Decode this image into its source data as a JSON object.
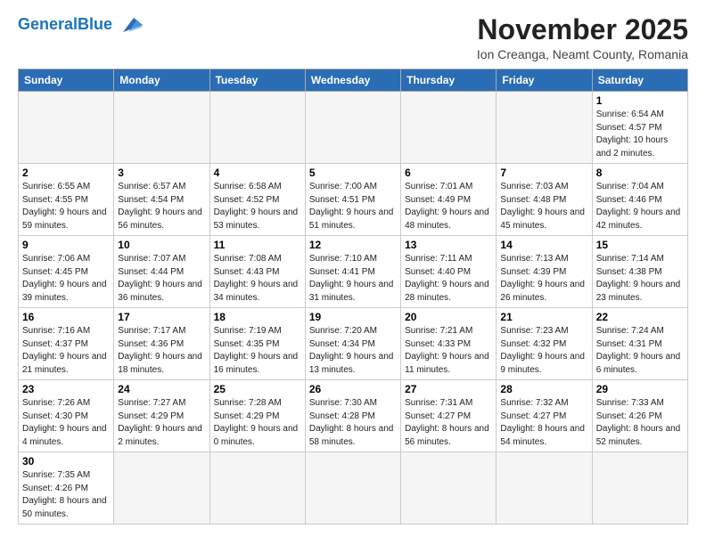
{
  "header": {
    "logo_general": "General",
    "logo_blue": "Blue",
    "title": "November 2025",
    "subtitle": "Ion Creanga, Neamt County, Romania"
  },
  "days_of_week": [
    "Sunday",
    "Monday",
    "Tuesday",
    "Wednesday",
    "Thursday",
    "Friday",
    "Saturday"
  ],
  "weeks": [
    [
      {
        "day": "",
        "info": ""
      },
      {
        "day": "",
        "info": ""
      },
      {
        "day": "",
        "info": ""
      },
      {
        "day": "",
        "info": ""
      },
      {
        "day": "",
        "info": ""
      },
      {
        "day": "",
        "info": ""
      },
      {
        "day": "1",
        "info": "Sunrise: 6:54 AM\nSunset: 4:57 PM\nDaylight: 10 hours and 2 minutes."
      }
    ],
    [
      {
        "day": "2",
        "info": "Sunrise: 6:55 AM\nSunset: 4:55 PM\nDaylight: 9 hours and 59 minutes."
      },
      {
        "day": "3",
        "info": "Sunrise: 6:57 AM\nSunset: 4:54 PM\nDaylight: 9 hours and 56 minutes."
      },
      {
        "day": "4",
        "info": "Sunrise: 6:58 AM\nSunset: 4:52 PM\nDaylight: 9 hours and 53 minutes."
      },
      {
        "day": "5",
        "info": "Sunrise: 7:00 AM\nSunset: 4:51 PM\nDaylight: 9 hours and 51 minutes."
      },
      {
        "day": "6",
        "info": "Sunrise: 7:01 AM\nSunset: 4:49 PM\nDaylight: 9 hours and 48 minutes."
      },
      {
        "day": "7",
        "info": "Sunrise: 7:03 AM\nSunset: 4:48 PM\nDaylight: 9 hours and 45 minutes."
      },
      {
        "day": "8",
        "info": "Sunrise: 7:04 AM\nSunset: 4:46 PM\nDaylight: 9 hours and 42 minutes."
      }
    ],
    [
      {
        "day": "9",
        "info": "Sunrise: 7:06 AM\nSunset: 4:45 PM\nDaylight: 9 hours and 39 minutes."
      },
      {
        "day": "10",
        "info": "Sunrise: 7:07 AM\nSunset: 4:44 PM\nDaylight: 9 hours and 36 minutes."
      },
      {
        "day": "11",
        "info": "Sunrise: 7:08 AM\nSunset: 4:43 PM\nDaylight: 9 hours and 34 minutes."
      },
      {
        "day": "12",
        "info": "Sunrise: 7:10 AM\nSunset: 4:41 PM\nDaylight: 9 hours and 31 minutes."
      },
      {
        "day": "13",
        "info": "Sunrise: 7:11 AM\nSunset: 4:40 PM\nDaylight: 9 hours and 28 minutes."
      },
      {
        "day": "14",
        "info": "Sunrise: 7:13 AM\nSunset: 4:39 PM\nDaylight: 9 hours and 26 minutes."
      },
      {
        "day": "15",
        "info": "Sunrise: 7:14 AM\nSunset: 4:38 PM\nDaylight: 9 hours and 23 minutes."
      }
    ],
    [
      {
        "day": "16",
        "info": "Sunrise: 7:16 AM\nSunset: 4:37 PM\nDaylight: 9 hours and 21 minutes."
      },
      {
        "day": "17",
        "info": "Sunrise: 7:17 AM\nSunset: 4:36 PM\nDaylight: 9 hours and 18 minutes."
      },
      {
        "day": "18",
        "info": "Sunrise: 7:19 AM\nSunset: 4:35 PM\nDaylight: 9 hours and 16 minutes."
      },
      {
        "day": "19",
        "info": "Sunrise: 7:20 AM\nSunset: 4:34 PM\nDaylight: 9 hours and 13 minutes."
      },
      {
        "day": "20",
        "info": "Sunrise: 7:21 AM\nSunset: 4:33 PM\nDaylight: 9 hours and 11 minutes."
      },
      {
        "day": "21",
        "info": "Sunrise: 7:23 AM\nSunset: 4:32 PM\nDaylight: 9 hours and 9 minutes."
      },
      {
        "day": "22",
        "info": "Sunrise: 7:24 AM\nSunset: 4:31 PM\nDaylight: 9 hours and 6 minutes."
      }
    ],
    [
      {
        "day": "23",
        "info": "Sunrise: 7:26 AM\nSunset: 4:30 PM\nDaylight: 9 hours and 4 minutes."
      },
      {
        "day": "24",
        "info": "Sunrise: 7:27 AM\nSunset: 4:29 PM\nDaylight: 9 hours and 2 minutes."
      },
      {
        "day": "25",
        "info": "Sunrise: 7:28 AM\nSunset: 4:29 PM\nDaylight: 9 hours and 0 minutes."
      },
      {
        "day": "26",
        "info": "Sunrise: 7:30 AM\nSunset: 4:28 PM\nDaylight: 8 hours and 58 minutes."
      },
      {
        "day": "27",
        "info": "Sunrise: 7:31 AM\nSunset: 4:27 PM\nDaylight: 8 hours and 56 minutes."
      },
      {
        "day": "28",
        "info": "Sunrise: 7:32 AM\nSunset: 4:27 PM\nDaylight: 8 hours and 54 minutes."
      },
      {
        "day": "29",
        "info": "Sunrise: 7:33 AM\nSunset: 4:26 PM\nDaylight: 8 hours and 52 minutes."
      }
    ],
    [
      {
        "day": "30",
        "info": "Sunrise: 7:35 AM\nSunset: 4:26 PM\nDaylight: 8 hours and 50 minutes."
      },
      {
        "day": "",
        "info": ""
      },
      {
        "day": "",
        "info": ""
      },
      {
        "day": "",
        "info": ""
      },
      {
        "day": "",
        "info": ""
      },
      {
        "day": "",
        "info": ""
      },
      {
        "day": "",
        "info": ""
      }
    ]
  ]
}
